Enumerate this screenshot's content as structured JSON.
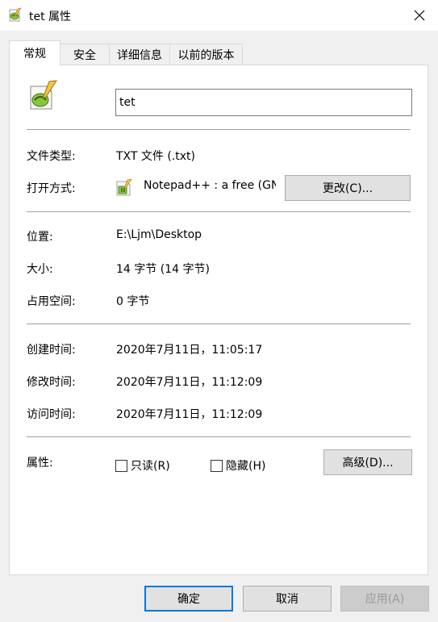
{
  "window": {
    "title": "tet 属性",
    "close_icon": "close-icon"
  },
  "tabs": [
    {
      "label": "常规",
      "active": true
    },
    {
      "label": "安全"
    },
    {
      "label": "详细信息"
    },
    {
      "label": "以前的版本"
    }
  ],
  "general": {
    "file_icon": "notepadpp-file-icon",
    "file_name": "tet",
    "file_type_label": "文件类型:",
    "file_type_value": "TXT 文件 (.txt)",
    "open_with_label": "打开方式:",
    "open_with_value": "Notepad++ : a free (GN",
    "change_button": "更改(C)...",
    "location_label": "位置:",
    "location_value": "E:\\Ljm\\Desktop",
    "size_label": "大小:",
    "size_value": "14 字节 (14 字节)",
    "size_on_disk_label": "占用空间:",
    "size_on_disk_value": "0 字节",
    "created_label": "创建时间:",
    "created_value": "2020年7月11日，11:05:17",
    "modified_label": "修改时间:",
    "modified_value": "2020年7月11日，11:12:09",
    "accessed_label": "访问时间:",
    "accessed_value": "2020年7月11日，11:12:09",
    "attributes_label": "属性:",
    "readonly_label": "只读(R)",
    "readonly_checked": false,
    "hidden_label": "隐藏(H)",
    "hidden_checked": false,
    "advanced_button": "高级(D)..."
  },
  "footer": {
    "ok": "确定",
    "cancel": "取消",
    "apply": "应用(A)"
  },
  "colors": {
    "accent": "#0078d7",
    "panel": "#ffffff",
    "background": "#f0f0f0"
  }
}
